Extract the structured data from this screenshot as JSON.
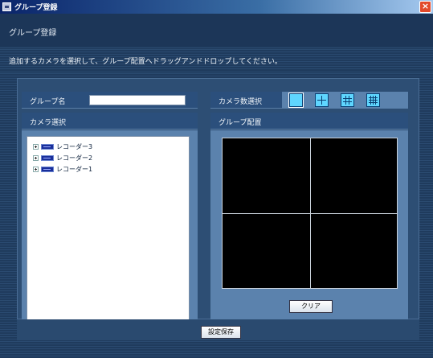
{
  "window": {
    "title": "グループ登録"
  },
  "header": {
    "label": "グループ登録"
  },
  "instruction": "追加するカメラを選択して、グループ配置へドラッグアンドドロップしてください。",
  "group_name": {
    "label": "グループ名",
    "value": ""
  },
  "camera_count": {
    "label": "カメラ数選択",
    "options": [
      "1",
      "4",
      "9",
      "16"
    ],
    "selected": "1"
  },
  "camera_select": {
    "label": "カメラ選択",
    "items": [
      {
        "label": "レコーダー3"
      },
      {
        "label": "レコーダー2"
      },
      {
        "label": "レコーダー1"
      }
    ]
  },
  "group_layout": {
    "label": "グループ配置"
  },
  "buttons": {
    "clear": "クリア",
    "save": "設定保存"
  },
  "colors": {
    "title_bar": "#0a246a",
    "panel": "#2d4e74",
    "accent_cyan": "#5fd6ff",
    "close": "#e24a2b"
  }
}
